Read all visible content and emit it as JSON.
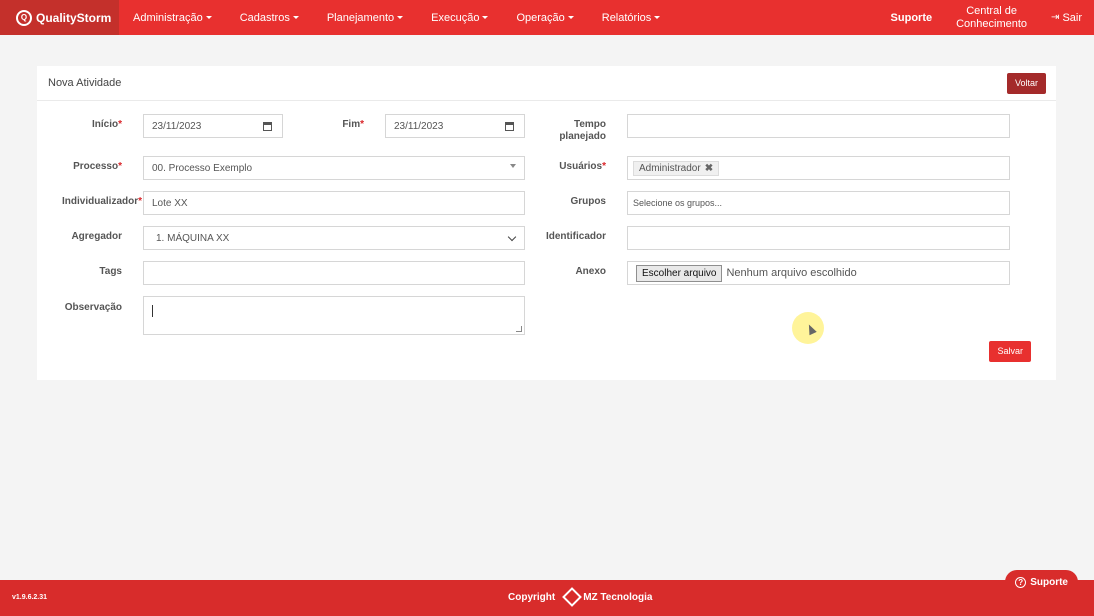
{
  "brand": {
    "name": "QualityStorm"
  },
  "nav": {
    "menu": [
      {
        "label": "Administração"
      },
      {
        "label": "Cadastros"
      },
      {
        "label": "Planejamento"
      },
      {
        "label": "Execução"
      },
      {
        "label": "Operação"
      },
      {
        "label": "Relatórios"
      }
    ],
    "suporte": "Suporte",
    "central": "Central de Conhecimento",
    "central_line1": "Central de",
    "central_line2": "Conhecimento",
    "sair": "Sair"
  },
  "form": {
    "title": "Nova Atividade",
    "voltar": "Voltar",
    "salvar": "Salvar",
    "required_mark": "*",
    "inicio": {
      "label": "Início",
      "value": "23/11/2023"
    },
    "fim": {
      "label": "Fim",
      "value": "23/11/2023"
    },
    "tempo_planejado": {
      "label_line1": "Tempo",
      "label_line2": "planejado",
      "value": ""
    },
    "processo": {
      "label": "Processo",
      "value": "00. Processo Exemplo"
    },
    "usuarios": {
      "label": "Usuários",
      "tag": "Administrador"
    },
    "individualizador": {
      "label": "Individualizador",
      "value": "Lote XX"
    },
    "grupos": {
      "label": "Grupos",
      "placeholder": "Selecione os grupos..."
    },
    "agregador": {
      "label": "Agregador",
      "value": "1. MÁQUINA XX"
    },
    "identificador": {
      "label": "Identificador",
      "value": ""
    },
    "tags": {
      "label": "Tags",
      "value": ""
    },
    "anexo": {
      "label": "Anexo",
      "button": "Escolher arquivo",
      "status": "Nenhum arquivo escolhido"
    },
    "observacao": {
      "label": "Observação",
      "value": ""
    }
  },
  "footer": {
    "version": "v1.9.6.2.31",
    "copyright": "Copyright",
    "company": "MZ Tecnologia",
    "support_button": "Suporte"
  },
  "colors": {
    "primary": "#e8302f",
    "dark_red": "#a42a2a",
    "background": "#f4f4f4"
  }
}
